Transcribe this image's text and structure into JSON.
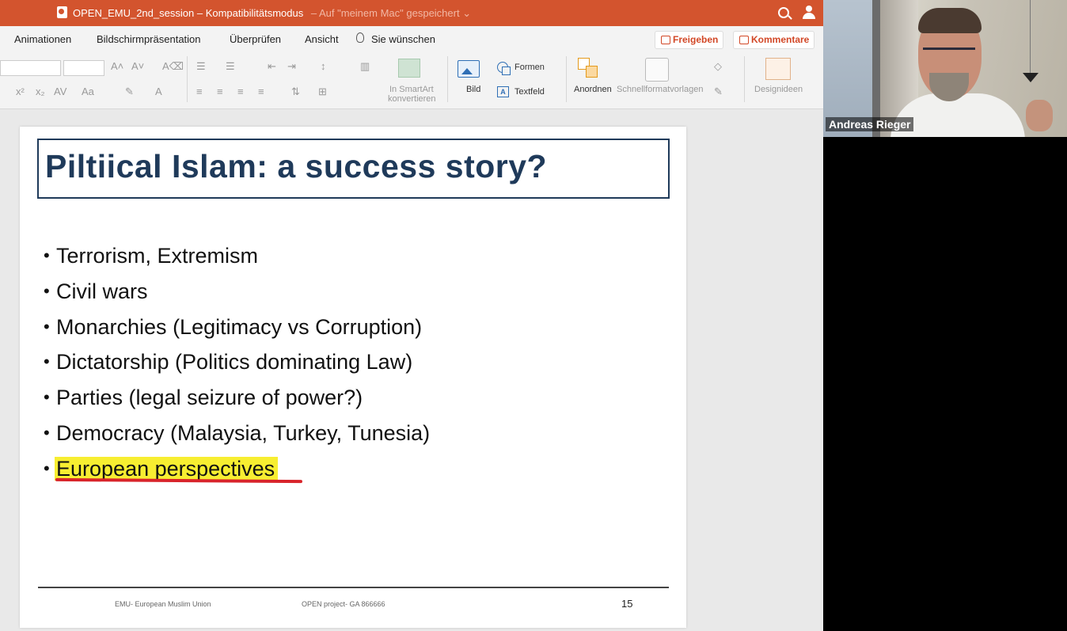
{
  "titlebar": {
    "document_title": "OPEN_EMU_2nd_session",
    "separator": "–",
    "mode": "Kompatibilitätsmodus",
    "saved_status": "– Auf \"meinem Mac\" gespeichert ⌄"
  },
  "menu": {
    "items": [
      "Animationen",
      "Bildschirmpräsentation",
      "Überprüfen",
      "Ansicht",
      "Sie wünschen"
    ],
    "share_label": "Freigeben",
    "comments_label": "Kommentare"
  },
  "ribbon": {
    "smartart_label_line1": "In SmartArt",
    "smartart_label_line2": "konvertieren",
    "picture_label": "Bild",
    "shapes_label": "Formen",
    "textbox_label": "Textfeld",
    "arrange_label": "Anordnen",
    "quickstyles_label": "Schnellformatvorlagen",
    "design_ideas_label": "Designideen"
  },
  "slide": {
    "title": "Piltiical Islam: a success story?",
    "bullets": [
      "Terrorism, Extremism",
      "Civil wars",
      "Monarchies (Legitimacy vs Corruption)",
      "Dictatorship (Politics dominating Law)",
      "Parties (legal seizure of power?)",
      "Democracy (Malaysia, Turkey, Tunesia)",
      "European perspectives"
    ],
    "highlighted_bullet_index": 6,
    "footer_left": "EMU- European Muslim Union",
    "footer_center": "OPEN project- GA 866666",
    "slide_number": "15"
  },
  "video": {
    "participant_name": "Andreas Rieger"
  },
  "colors": {
    "titlebar_bg": "#d3542e",
    "accent": "#d24726",
    "slide_title": "#1f3a5a",
    "highlight": "#f7ee31",
    "underline": "#d8242b"
  }
}
